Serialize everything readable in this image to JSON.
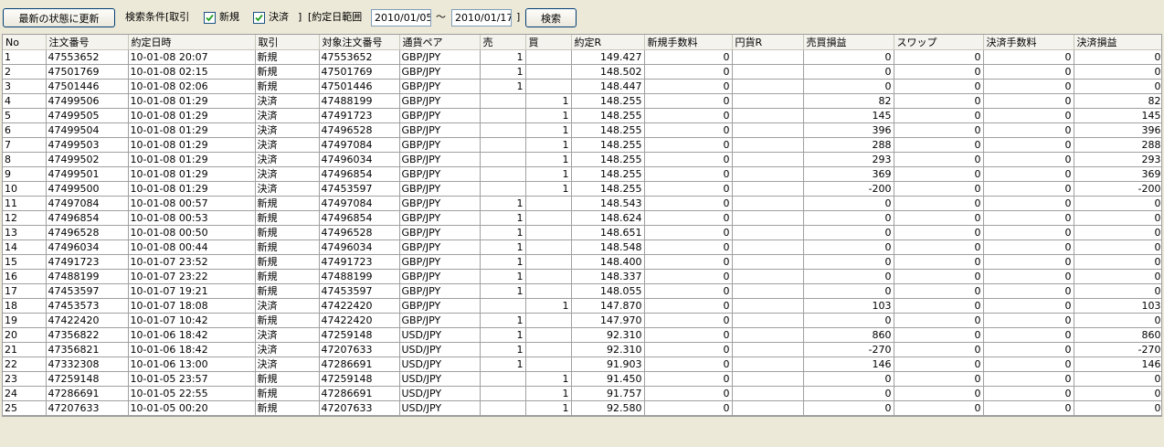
{
  "toolbar": {
    "refresh_label": "最新の状態に更新",
    "search_condition_label": "検索条件[取引",
    "new_label": "新規",
    "new_checked": true,
    "settle_label": "決済",
    "settle_checked": true,
    "bracket_close": "]",
    "date_range_label": "[約定日範囲",
    "date_from": "2010/01/05",
    "tilde": "～",
    "date_to": "2010/01/17",
    "date_bracket_close": "]",
    "search_label": "検索"
  },
  "table": {
    "columns": [
      "No",
      "注文番号",
      "約定日時",
      "取引",
      "対象注文番号",
      "通貨ペア",
      "売",
      "買",
      "約定R",
      "新規手数料",
      "円貨R",
      "売買損益",
      "スワップ",
      "決済手数料",
      "決済損益"
    ],
    "rows": [
      [
        "1",
        "47553652",
        "10-01-08 20:07",
        "新規",
        "47553652",
        "GBP/JPY",
        "1",
        "",
        "149.427",
        "0",
        "",
        "0",
        "0",
        "0",
        "0"
      ],
      [
        "2",
        "47501769",
        "10-01-08 02:15",
        "新規",
        "47501769",
        "GBP/JPY",
        "1",
        "",
        "148.502",
        "0",
        "",
        "0",
        "0",
        "0",
        "0"
      ],
      [
        "3",
        "47501446",
        "10-01-08 02:06",
        "新規",
        "47501446",
        "GBP/JPY",
        "1",
        "",
        "148.447",
        "0",
        "",
        "0",
        "0",
        "0",
        "0"
      ],
      [
        "4",
        "47499506",
        "10-01-08 01:29",
        "決済",
        "47488199",
        "GBP/JPY",
        "",
        "1",
        "148.255",
        "0",
        "",
        "82",
        "0",
        "0",
        "82"
      ],
      [
        "5",
        "47499505",
        "10-01-08 01:29",
        "決済",
        "47491723",
        "GBP/JPY",
        "",
        "1",
        "148.255",
        "0",
        "",
        "145",
        "0",
        "0",
        "145"
      ],
      [
        "6",
        "47499504",
        "10-01-08 01:29",
        "決済",
        "47496528",
        "GBP/JPY",
        "",
        "1",
        "148.255",
        "0",
        "",
        "396",
        "0",
        "0",
        "396"
      ],
      [
        "7",
        "47499503",
        "10-01-08 01:29",
        "決済",
        "47497084",
        "GBP/JPY",
        "",
        "1",
        "148.255",
        "0",
        "",
        "288",
        "0",
        "0",
        "288"
      ],
      [
        "8",
        "47499502",
        "10-01-08 01:29",
        "決済",
        "47496034",
        "GBP/JPY",
        "",
        "1",
        "148.255",
        "0",
        "",
        "293",
        "0",
        "0",
        "293"
      ],
      [
        "9",
        "47499501",
        "10-01-08 01:29",
        "決済",
        "47496854",
        "GBP/JPY",
        "",
        "1",
        "148.255",
        "0",
        "",
        "369",
        "0",
        "0",
        "369"
      ],
      [
        "10",
        "47499500",
        "10-01-08 01:29",
        "決済",
        "47453597",
        "GBP/JPY",
        "",
        "1",
        "148.255",
        "0",
        "",
        "-200",
        "0",
        "0",
        "-200"
      ],
      [
        "11",
        "47497084",
        "10-01-08 00:57",
        "新規",
        "47497084",
        "GBP/JPY",
        "1",
        "",
        "148.543",
        "0",
        "",
        "0",
        "0",
        "0",
        "0"
      ],
      [
        "12",
        "47496854",
        "10-01-08 00:53",
        "新規",
        "47496854",
        "GBP/JPY",
        "1",
        "",
        "148.624",
        "0",
        "",
        "0",
        "0",
        "0",
        "0"
      ],
      [
        "13",
        "47496528",
        "10-01-08 00:50",
        "新規",
        "47496528",
        "GBP/JPY",
        "1",
        "",
        "148.651",
        "0",
        "",
        "0",
        "0",
        "0",
        "0"
      ],
      [
        "14",
        "47496034",
        "10-01-08 00:44",
        "新規",
        "47496034",
        "GBP/JPY",
        "1",
        "",
        "148.548",
        "0",
        "",
        "0",
        "0",
        "0",
        "0"
      ],
      [
        "15",
        "47491723",
        "10-01-07 23:52",
        "新規",
        "47491723",
        "GBP/JPY",
        "1",
        "",
        "148.400",
        "0",
        "",
        "0",
        "0",
        "0",
        "0"
      ],
      [
        "16",
        "47488199",
        "10-01-07 23:22",
        "新規",
        "47488199",
        "GBP/JPY",
        "1",
        "",
        "148.337",
        "0",
        "",
        "0",
        "0",
        "0",
        "0"
      ],
      [
        "17",
        "47453597",
        "10-01-07 19:21",
        "新規",
        "47453597",
        "GBP/JPY",
        "1",
        "",
        "148.055",
        "0",
        "",
        "0",
        "0",
        "0",
        "0"
      ],
      [
        "18",
        "47453573",
        "10-01-07 18:08",
        "決済",
        "47422420",
        "GBP/JPY",
        "",
        "1",
        "147.870",
        "0",
        "",
        "103",
        "0",
        "0",
        "103"
      ],
      [
        "19",
        "47422420",
        "10-01-07 10:42",
        "新規",
        "47422420",
        "GBP/JPY",
        "1",
        "",
        "147.970",
        "0",
        "",
        "0",
        "0",
        "0",
        "0"
      ],
      [
        "20",
        "47356822",
        "10-01-06 18:42",
        "決済",
        "47259148",
        "USD/JPY",
        "1",
        "",
        "92.310",
        "0",
        "",
        "860",
        "0",
        "0",
        "860"
      ],
      [
        "21",
        "47356821",
        "10-01-06 18:42",
        "決済",
        "47207633",
        "USD/JPY",
        "1",
        "",
        "92.310",
        "0",
        "",
        "-270",
        "0",
        "0",
        "-270"
      ],
      [
        "22",
        "47332308",
        "10-01-06 13:00",
        "決済",
        "47286691",
        "USD/JPY",
        "1",
        "",
        "91.903",
        "0",
        "",
        "146",
        "0",
        "0",
        "146"
      ],
      [
        "23",
        "47259148",
        "10-01-05 23:57",
        "新規",
        "47259148",
        "USD/JPY",
        "",
        "1",
        "91.450",
        "0",
        "",
        "0",
        "0",
        "0",
        "0"
      ],
      [
        "24",
        "47286691",
        "10-01-05 22:55",
        "新規",
        "47286691",
        "USD/JPY",
        "",
        "1",
        "91.757",
        "0",
        "",
        "0",
        "0",
        "0",
        "0"
      ],
      [
        "25",
        "47207633",
        "10-01-05 00:20",
        "新規",
        "47207633",
        "USD/JPY",
        "",
        "1",
        "92.580",
        "0",
        "",
        "0",
        "0",
        "0",
        "0"
      ]
    ]
  }
}
